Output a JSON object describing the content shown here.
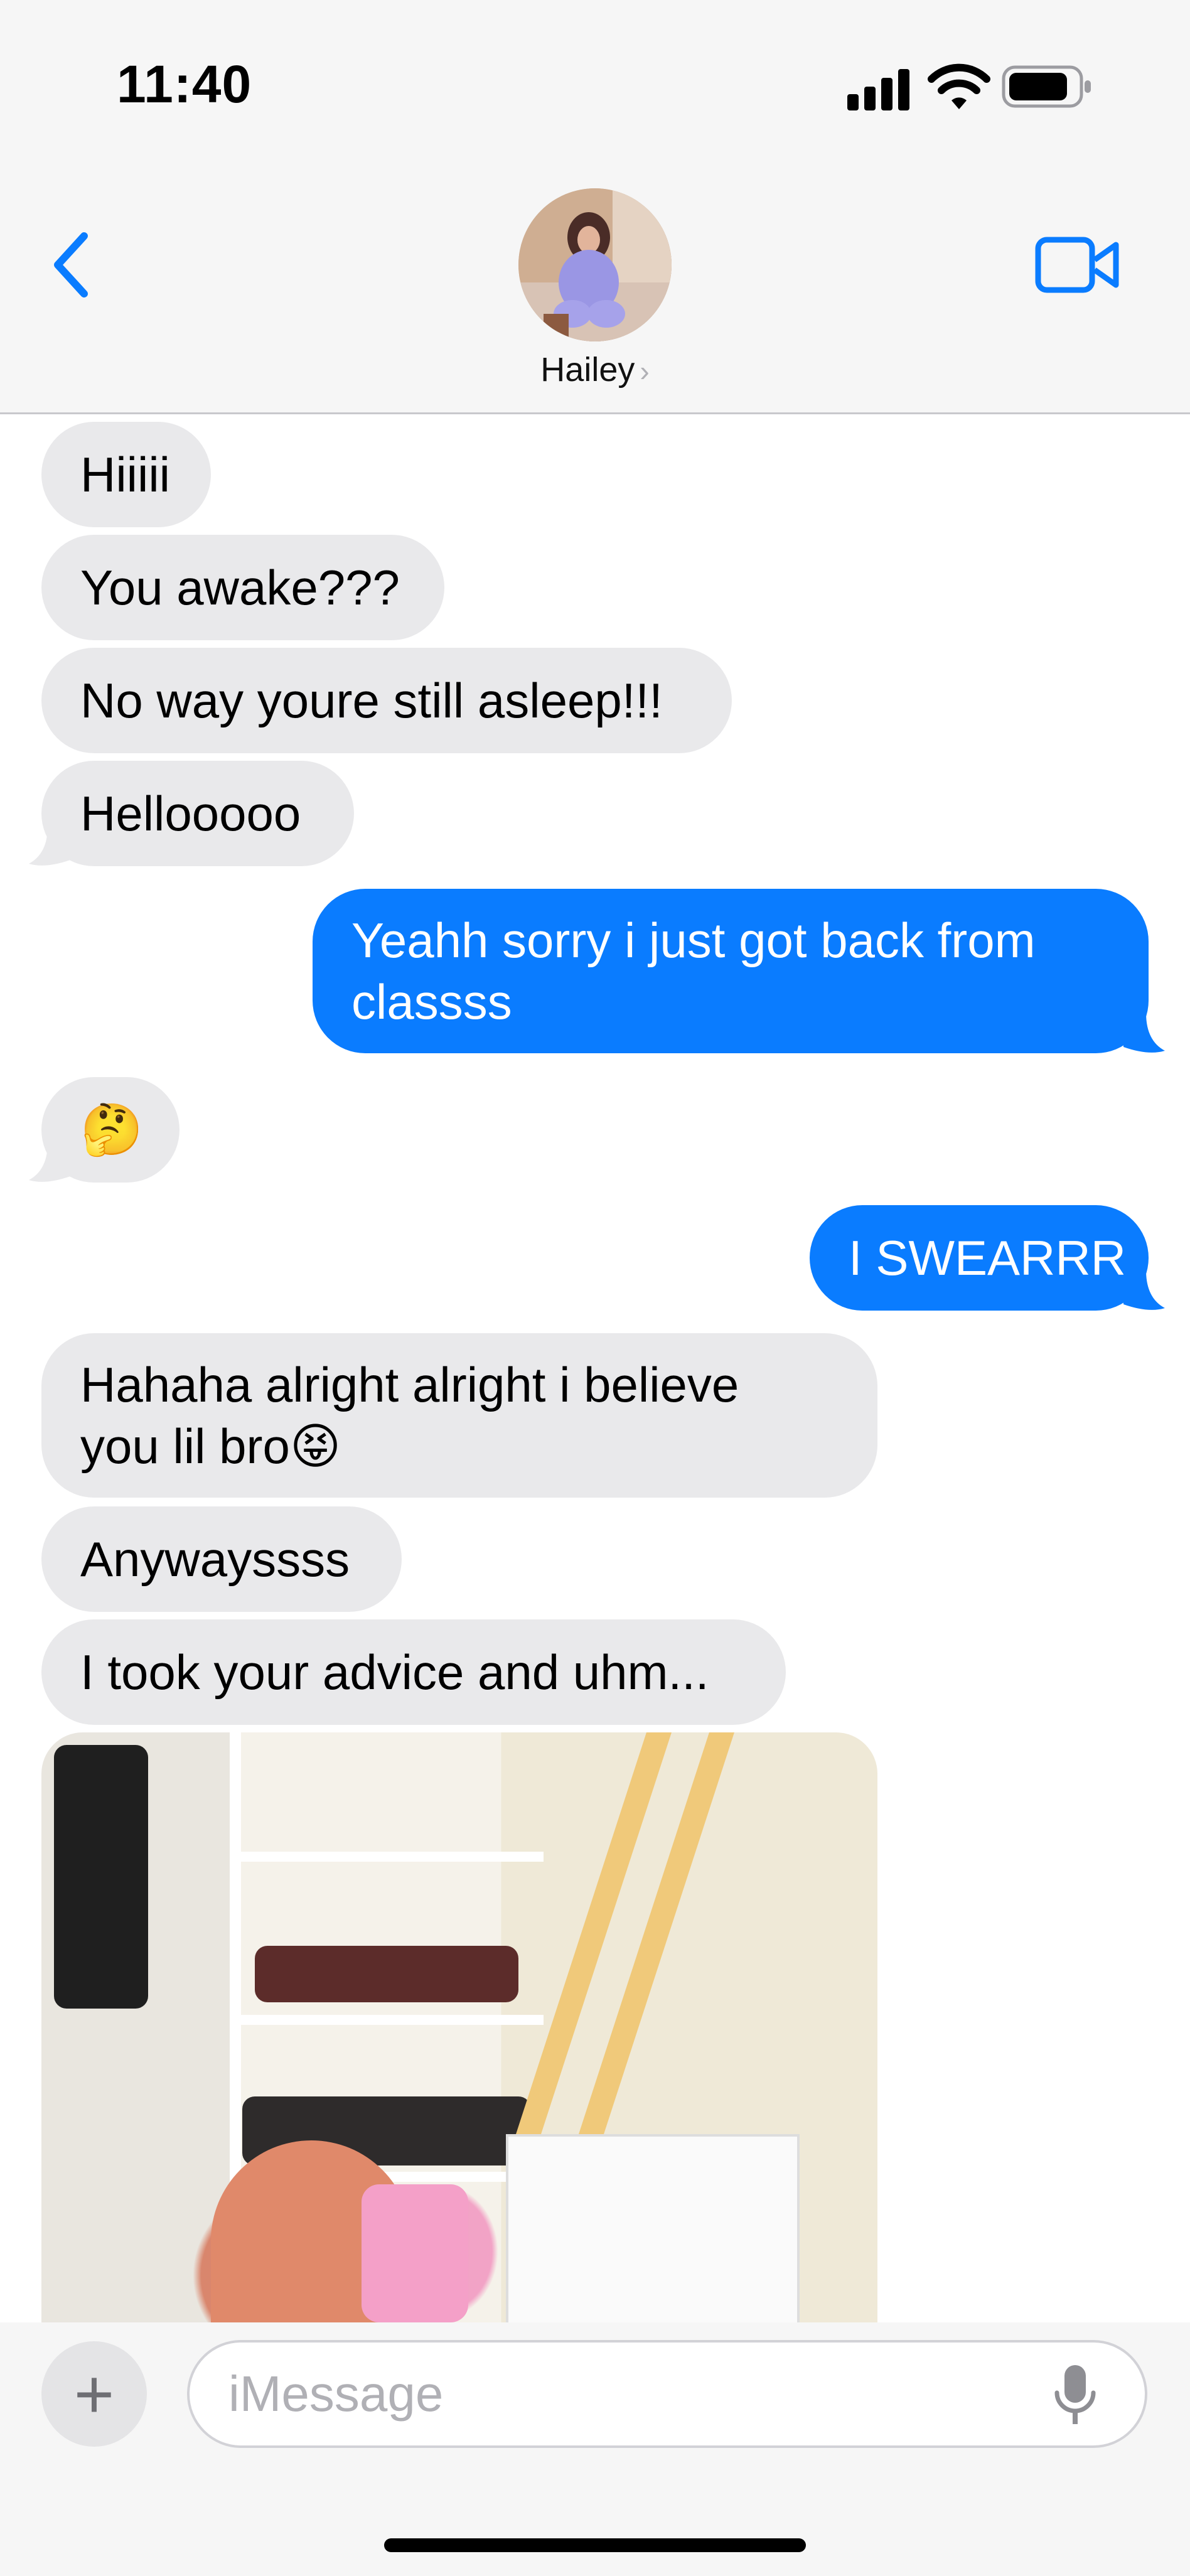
{
  "status_bar": {
    "time": "11:40"
  },
  "header": {
    "contact_name": "Hailey",
    "chevron": "›"
  },
  "messages": [
    {
      "from": "contact",
      "text": "Hiiiii"
    },
    {
      "from": "contact",
      "text": "You awake???"
    },
    {
      "from": "contact",
      "text": "No way youre still asleep!!!"
    },
    {
      "from": "contact",
      "text": "Hellooooo"
    },
    {
      "from": "me",
      "line1": "Yeahh sorry i just got back from",
      "line2": "classss"
    },
    {
      "from": "contact",
      "text": "🤔"
    },
    {
      "from": "me",
      "text": "I SWEARRR"
    },
    {
      "from": "contact",
      "line1": "Hahaha alright alright i believe",
      "line2": "you lil bro😝"
    },
    {
      "from": "contact",
      "text": "Anywayssss"
    },
    {
      "from": "contact",
      "text": "I took your advice and uhm..."
    }
  ],
  "compose": {
    "placeholder": "iMessage",
    "plus": "+"
  },
  "colors": {
    "outgoing": "#0a7cff",
    "incoming": "#e9e9eb",
    "accent": "#0a7cff"
  },
  "icons": [
    "back-chevron-icon",
    "facetime-video-icon",
    "signal-icon",
    "wifi-icon",
    "battery-icon",
    "plus-icon",
    "microphone-icon"
  ]
}
